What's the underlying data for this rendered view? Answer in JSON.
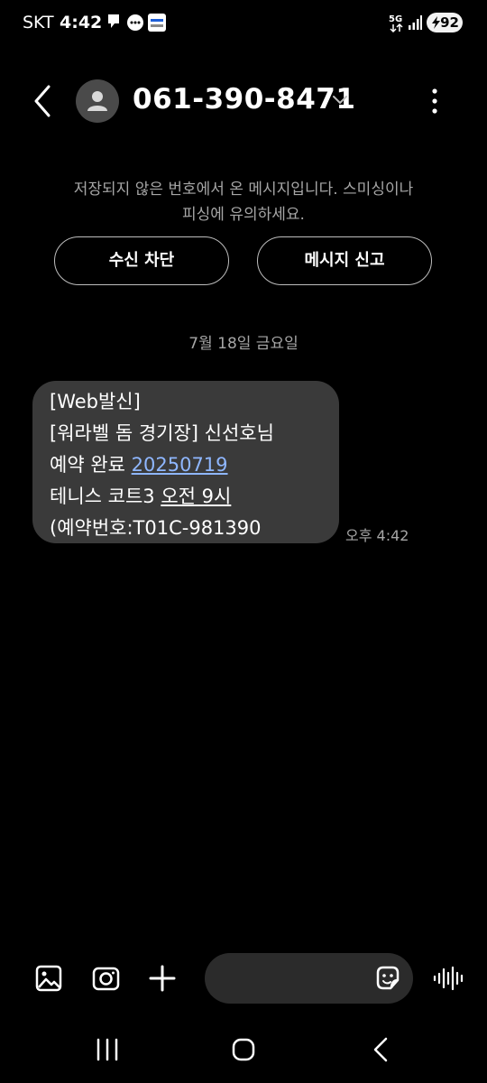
{
  "status_bar": {
    "carrier": "SKT",
    "time": "4:42",
    "network": "5G",
    "battery": "92",
    "icons": [
      "message-notification-icon",
      "chat-bubble-icon",
      "app-notification-icon",
      "5g-icon",
      "signal-icon",
      "battery-icon"
    ]
  },
  "header": {
    "title": "061-390-8471",
    "icons": [
      "back-arrow-icon",
      "avatar-icon",
      "chevron-down-icon",
      "more-vertical-icon"
    ]
  },
  "warning": {
    "line1": "저장되지 않은 번호에서 온 메시지입니다. 스미싱이나",
    "line2": "피싱에 유의하세요."
  },
  "actions": {
    "block_label": "수신 차단",
    "report_label": "메시지 신고"
  },
  "date_separator": "7월 18일 금요일",
  "message": {
    "line1": "[Web발신]",
    "line2": "[워라벨 돔 경기장] 신선호님",
    "line3_prefix": "예약 완료 ",
    "line3_link": "20250719",
    "line4_prefix": "테니스 코트3 ",
    "line4_underlined": "오전 9시",
    "line5": "(예약번호:T01C-981390",
    "time": "오후 4:42"
  },
  "composer": {
    "icons": [
      "gallery-icon",
      "camera-icon",
      "plus-icon",
      "emoji-sticker-icon",
      "voice-wave-icon"
    ]
  },
  "nav": {
    "icons": [
      "recent-apps-icon",
      "home-icon",
      "back-icon"
    ]
  },
  "colors": {
    "background": "#000000",
    "bubble": "#3a3a3a",
    "link": "#8fb7ff",
    "secondary_text": "#a6a6a6",
    "input_pill": "#2b2b2b"
  }
}
